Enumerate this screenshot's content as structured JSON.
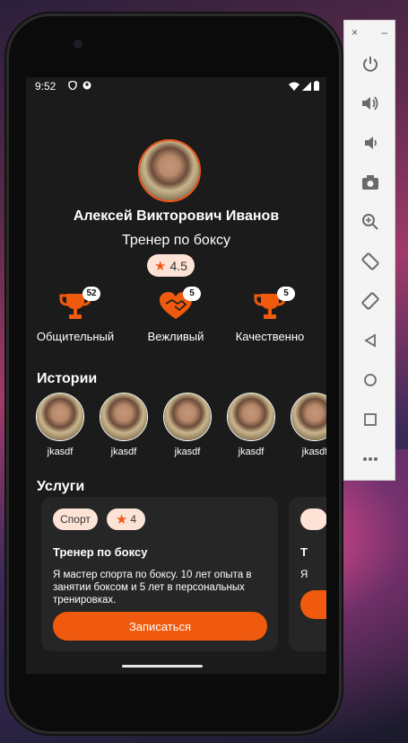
{
  "status_bar": {
    "time": "9:52"
  },
  "profile": {
    "name": "Алексей Викторович Иванов",
    "role": "Тренер по боксу",
    "rating": "4.5"
  },
  "badges": [
    {
      "label": "Общительный",
      "count": "52",
      "icon": "trophy-icon"
    },
    {
      "label": "Вежливый",
      "count": "5",
      "icon": "handshake-heart-icon"
    },
    {
      "label": "Качественно",
      "count": "5",
      "icon": "trophy-icon"
    }
  ],
  "stories": {
    "title": "Истории",
    "items": [
      "jkasdf",
      "jkasdf",
      "jkasdf",
      "jkasdf",
      "jkasdf"
    ]
  },
  "services": {
    "title": "Услуги",
    "cards": [
      {
        "tag": "Спорт",
        "rating": "4",
        "title": "Тренер по боксу",
        "description": "Я мастер спорта по боксу. 10 лет опыта в занятии боксом и 5 лет в персональных тренировках.",
        "button": "Записаться"
      },
      {
        "title_partial": "Т",
        "desc_partial": "Я"
      }
    ]
  },
  "emulator_panel": {
    "top": {
      "close": "×",
      "minimize": "–"
    },
    "buttons": [
      "power-icon",
      "volume-up-icon",
      "volume-down-icon",
      "camera-icon",
      "zoom-icon",
      "rotate-left-icon",
      "rotate-right-icon",
      "back-icon",
      "home-icon",
      "overview-icon",
      "more-icon"
    ]
  },
  "colors": {
    "accent": "#F05A0E",
    "pill": "#FDE3D6",
    "surface": "#1B1B1B",
    "card": "#262626"
  }
}
